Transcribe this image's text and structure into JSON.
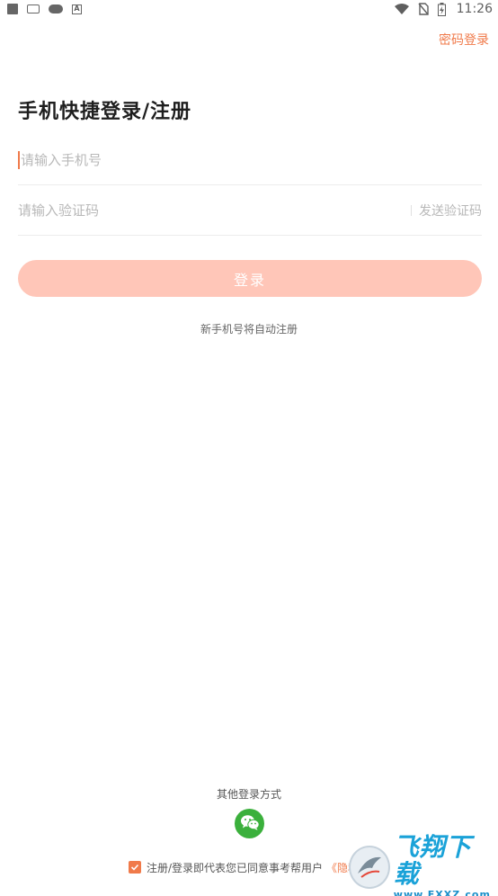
{
  "status_bar": {
    "time": "11:26",
    "icons": [
      "notification-square-icon",
      "keyboard-icon",
      "cloud-icon",
      "a-icon",
      "wifi-icon",
      "no-sim-icon",
      "battery-charging-icon"
    ]
  },
  "header": {
    "password_login": "密码登录",
    "title": "手机快捷登录/注册"
  },
  "form": {
    "phone_placeholder": "请输入手机号",
    "phone_value": "",
    "code_placeholder": "请输入验证码",
    "code_value": "",
    "send_code_label": "发送验证码",
    "login_label": "登录",
    "auto_register_note": "新手机号将自动注册"
  },
  "other_login": {
    "label": "其他登录方式",
    "methods": [
      "wechat-icon"
    ]
  },
  "agreement": {
    "checked": true,
    "text": "注册/登录即代表您已同意事考帮用户",
    "privacy_link": "《隐私协"
  },
  "watermark": {
    "title": "飞翔下载",
    "url": "www.FXXZ.com"
  },
  "colors": {
    "accent": "#f07a4a",
    "login_button_disabled": "#ffc6b8",
    "wechat_green": "#3bb03c"
  }
}
